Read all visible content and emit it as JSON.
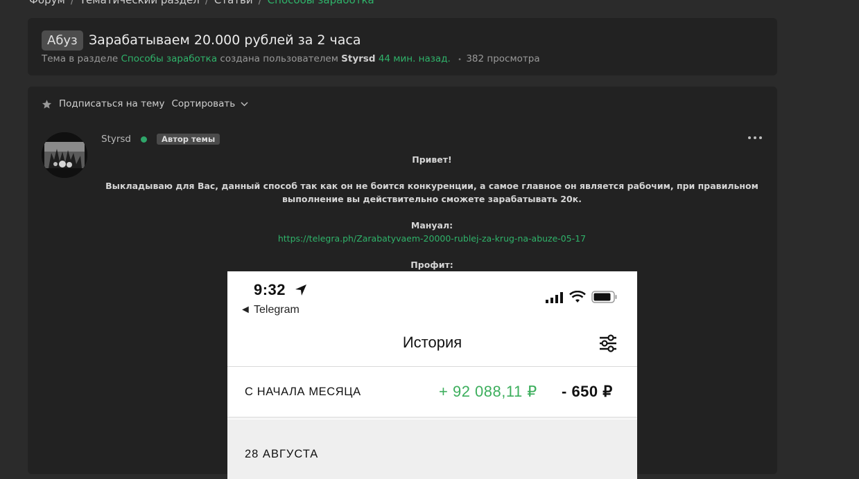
{
  "breadcrumbs": [
    {
      "label": "Форум"
    },
    {
      "label": "Тематический раздел"
    },
    {
      "label": "Статьи"
    },
    {
      "label": "Способы заработка"
    }
  ],
  "breadcrumb_separator": "/",
  "thread": {
    "prefix": "Абуз",
    "title": "Зарабатываем 20.000 рублей за 2 часа",
    "meta": {
      "lead": "Тема в разделе",
      "section": "Способы заработка",
      "created_by": "создана пользователем",
      "author": "Styrsd",
      "time_ago": "44 мин. назад.",
      "views": "382 просмотра"
    }
  },
  "toolbar": {
    "subscribe_label": "Подписаться на тему",
    "sort_label": "Сортировать"
  },
  "post": {
    "author": "Styrsd",
    "author_badge": "Автор темы",
    "greeting": "Привет!",
    "paragraph": "Выкладываю для Вас, данный способ так как он не боится конкуренции, а самое главное он является рабочим, при правильном выполнение вы действительно сможете зарабатывать 20к.",
    "manual_label": "Мануал:",
    "manual_link": "https://telegra.ph/Zarabatyvaem-20000-rublej-za-krug-na-abuze-05-17",
    "profit_label": "Профит:"
  },
  "screenshot": {
    "time": "9:32",
    "back_label": "◄ Telegram",
    "title": "История",
    "month_label": "С НАЧАЛА МЕСЯЦА",
    "income": "+ 92 088,11 ₽",
    "expense": "- 650 ₽",
    "date_label": "28 АВГУСТА"
  },
  "colors": {
    "accent_green": "#2fb36a",
    "page_bg": "#2b2b2b",
    "card_bg": "#222222"
  }
}
